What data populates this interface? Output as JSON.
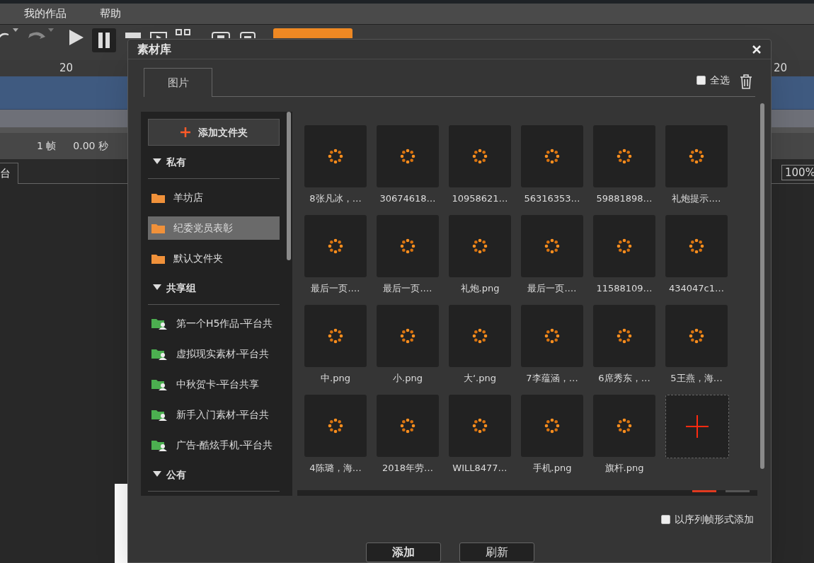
{
  "menu": [
    {
      "label": "我的作品"
    },
    {
      "label": "帮助"
    }
  ],
  "ruler": {
    "left_label": "20",
    "right_label": "20"
  },
  "timeline_status": [
    "1 帧",
    "0.00 秒"
  ],
  "stage_tab": {
    "label": "台"
  },
  "zoom_field": {
    "value": "100%"
  },
  "dialog": {
    "title": "素材库",
    "tabs": [
      {
        "label": "图片",
        "selected": true
      }
    ],
    "select_all": {
      "label": "全选",
      "checked": false
    },
    "add_folder_button": "添加文件夹",
    "groups": [
      {
        "label": "私有",
        "expanded": true,
        "items": [
          {
            "label": "羊坊店",
            "kind": "folder",
            "selected": false
          },
          {
            "label": "纪委党员表彰",
            "kind": "folder",
            "selected": true
          },
          {
            "label": "默认文件夹",
            "kind": "folder",
            "selected": false
          }
        ]
      },
      {
        "label": "共享组",
        "expanded": true,
        "items": [
          {
            "label": "第一个H5作品-平台共",
            "kind": "shared",
            "selected": false
          },
          {
            "label": "虚拟现实素材-平台共",
            "kind": "shared",
            "selected": false
          },
          {
            "label": "中秋贺卡-平台共享",
            "kind": "shared",
            "selected": false
          },
          {
            "label": "新手入门素材-平台共",
            "kind": "shared",
            "selected": false
          },
          {
            "label": "广告-酷炫手机-平台共",
            "kind": "shared",
            "selected": false
          }
        ]
      },
      {
        "label": "公有",
        "expanded": true
      }
    ],
    "assets": [
      {
        "name": "8张凡冰，…"
      },
      {
        "name": "30674618…"
      },
      {
        "name": "10958621…"
      },
      {
        "name": "56316353…"
      },
      {
        "name": "59881898…"
      },
      {
        "name": "礼炮提示.…"
      },
      {
        "name": "最后一页.…"
      },
      {
        "name": "最后一页.…"
      },
      {
        "name": "礼炮.png"
      },
      {
        "name": "最后一页.…"
      },
      {
        "name": "11588109…"
      },
      {
        "name": "434047c1…"
      },
      {
        "name": "中.png"
      },
      {
        "name": "小.png"
      },
      {
        "name": "大‘.png"
      },
      {
        "name": "7李蕴涵，…"
      },
      {
        "name": "6席秀东，…"
      },
      {
        "name": "5王燕，海…"
      },
      {
        "name": "4陈璐，海…"
      },
      {
        "name": "2018年劳…"
      },
      {
        "name": "WILL8477…"
      },
      {
        "name": "手机.png"
      },
      {
        "name": "旗杆.png"
      }
    ],
    "sequence_checkbox": {
      "label": "以序列帧形式添加",
      "checked": false
    },
    "buttons": [
      {
        "label": "添加",
        "primary": true
      },
      {
        "label": "刷新",
        "primary": false
      }
    ]
  }
}
